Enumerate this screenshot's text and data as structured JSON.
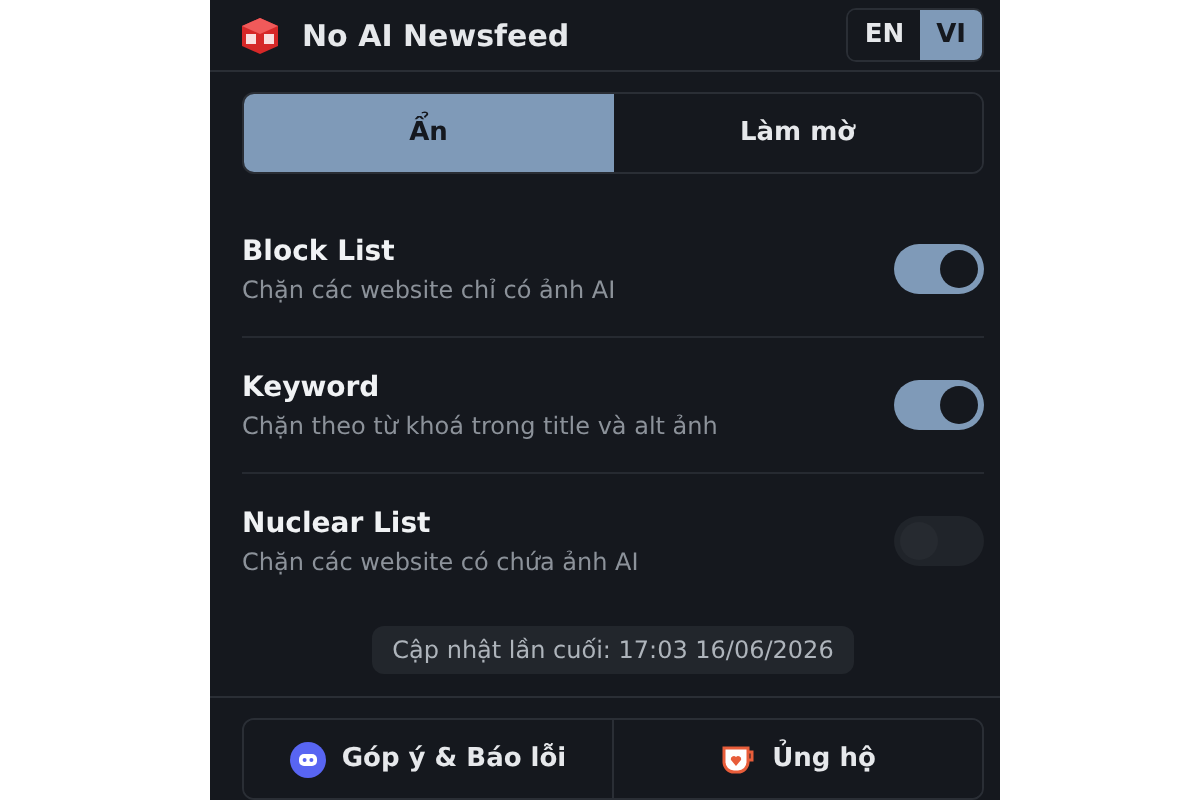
{
  "header": {
    "title": "No AI Newsfeed",
    "languages": [
      {
        "label": "EN",
        "selected": false
      },
      {
        "label": "VI",
        "selected": true
      }
    ]
  },
  "mode_tabs": [
    {
      "label": "Ẩn",
      "selected": true
    },
    {
      "label": "Làm mờ",
      "selected": false
    }
  ],
  "settings": [
    {
      "title": "Block List",
      "description": "Chặn các website chỉ có ảnh AI",
      "on": true
    },
    {
      "title": "Keyword",
      "description": "Chặn theo từ khoá trong title và alt ảnh",
      "on": true
    },
    {
      "title": "Nuclear List",
      "description": "Chặn các website có chứa ảnh AI",
      "on": false
    }
  ],
  "last_updated": "Cập nhật lần cuối: 17:03 16/06/2026",
  "footer_buttons": [
    {
      "kind": "feedback",
      "label": "Góp ý & Báo lỗi"
    },
    {
      "kind": "support",
      "label": "Ủng hộ"
    }
  ]
}
